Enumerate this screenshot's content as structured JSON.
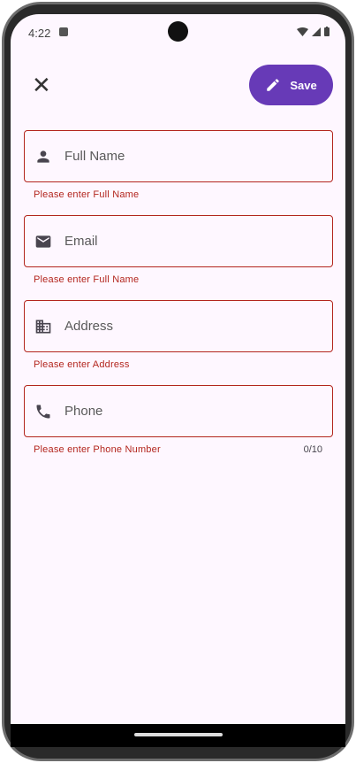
{
  "status": {
    "time": "4:22"
  },
  "toolbar": {
    "close_label": "✕",
    "save_label": "Save"
  },
  "fields": [
    {
      "placeholder": "Full Name",
      "error": "Please enter Full Name",
      "icon": "person-icon"
    },
    {
      "placeholder": "Email",
      "error": "Please enter Full Name",
      "icon": "email-icon"
    },
    {
      "placeholder": "Address",
      "error": "Please enter Address",
      "icon": "business-icon"
    },
    {
      "placeholder": "Phone",
      "error": "Please enter Phone Number",
      "icon": "phone-icon",
      "counter": "0/10"
    }
  ],
  "colors": {
    "accent": "#673ab7",
    "error": "#b3261e"
  }
}
